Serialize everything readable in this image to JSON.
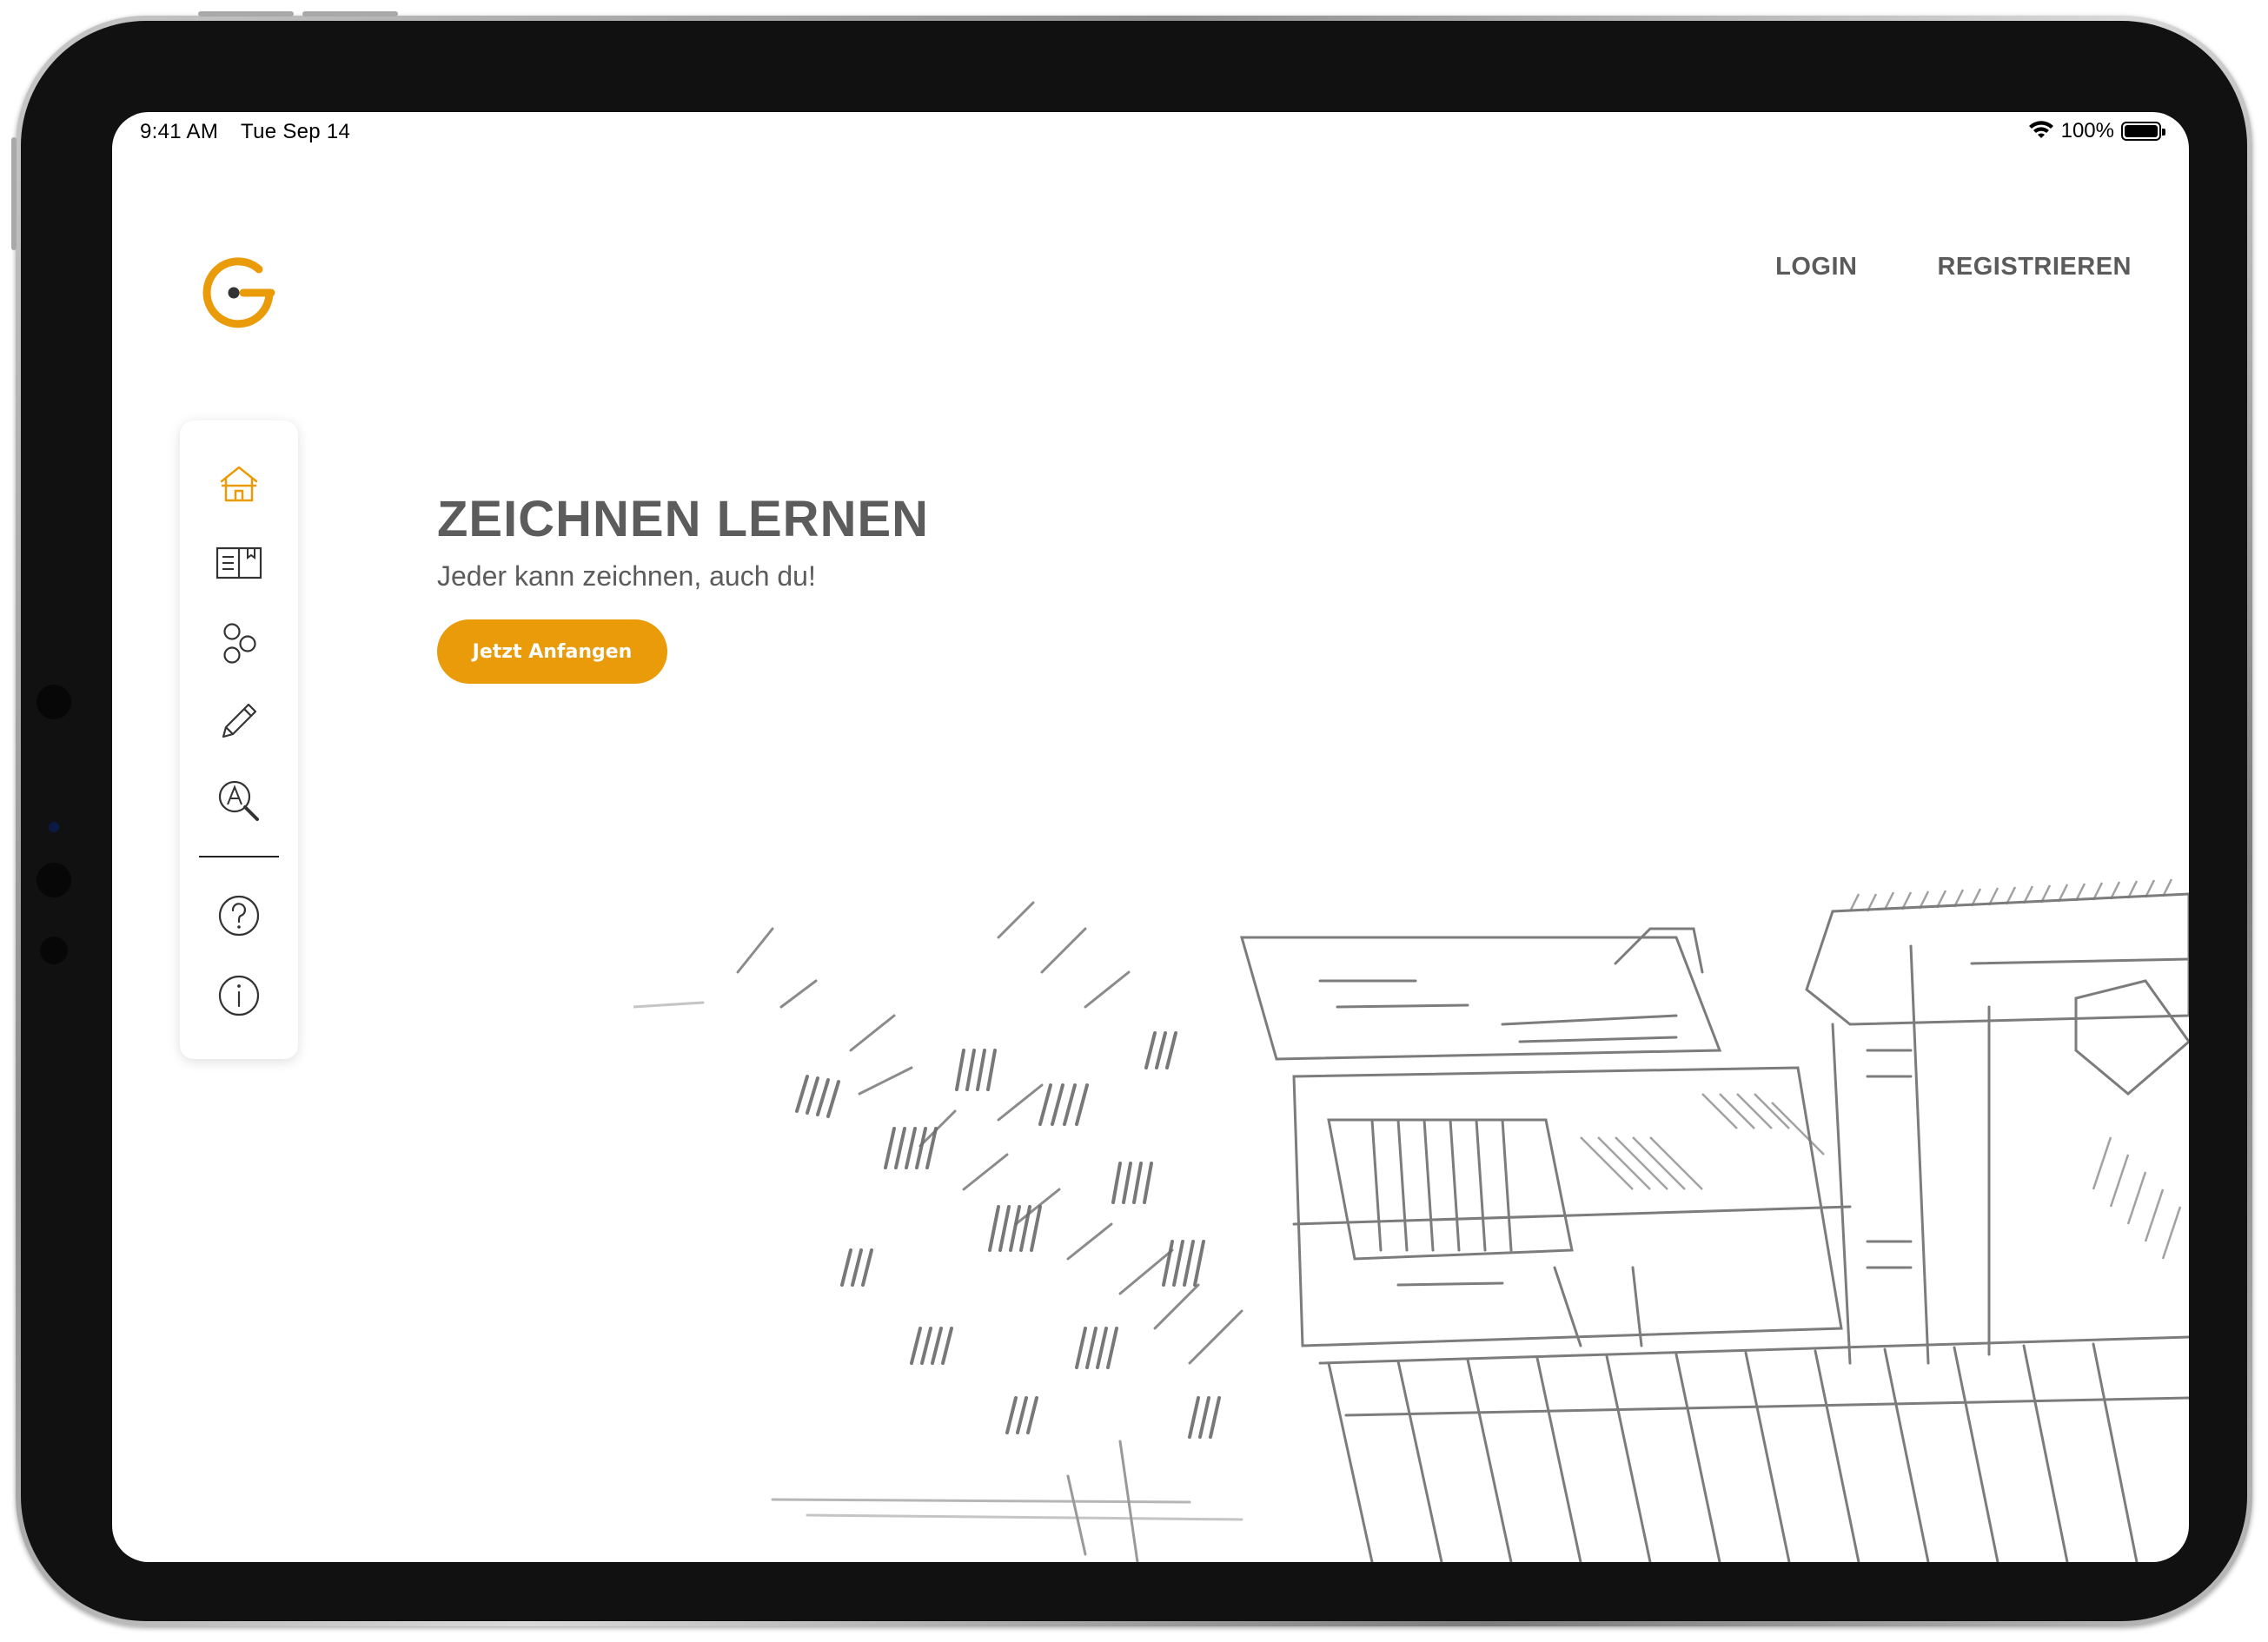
{
  "status_bar": {
    "time": "9:41 AM",
    "date": "Tue Sep 14",
    "battery": "100%",
    "icons": [
      "wifi-icon",
      "battery-icon"
    ]
  },
  "brand": {
    "logo_icon": "g-logo-icon",
    "accent_color": "#e99b0a",
    "text_color": "#5c5c5c"
  },
  "nav": {
    "login": "LOGIN",
    "register": "REGISTRIEREN"
  },
  "sidebar": {
    "items": [
      {
        "icon": "home-icon",
        "active": true
      },
      {
        "icon": "book-icon",
        "active": false
      },
      {
        "icon": "circles-icon",
        "active": false
      },
      {
        "icon": "pencil-icon",
        "active": false
      },
      {
        "icon": "search-letter-icon",
        "active": false
      },
      {
        "icon": "help-icon",
        "active": false
      },
      {
        "icon": "info-icon",
        "active": false
      }
    ]
  },
  "hero": {
    "title": "ZEICHNEN LERNEN",
    "subtitle": "Jeder kann zeichnen, auch du!",
    "cta_label": "Jetzt Anfangen"
  }
}
